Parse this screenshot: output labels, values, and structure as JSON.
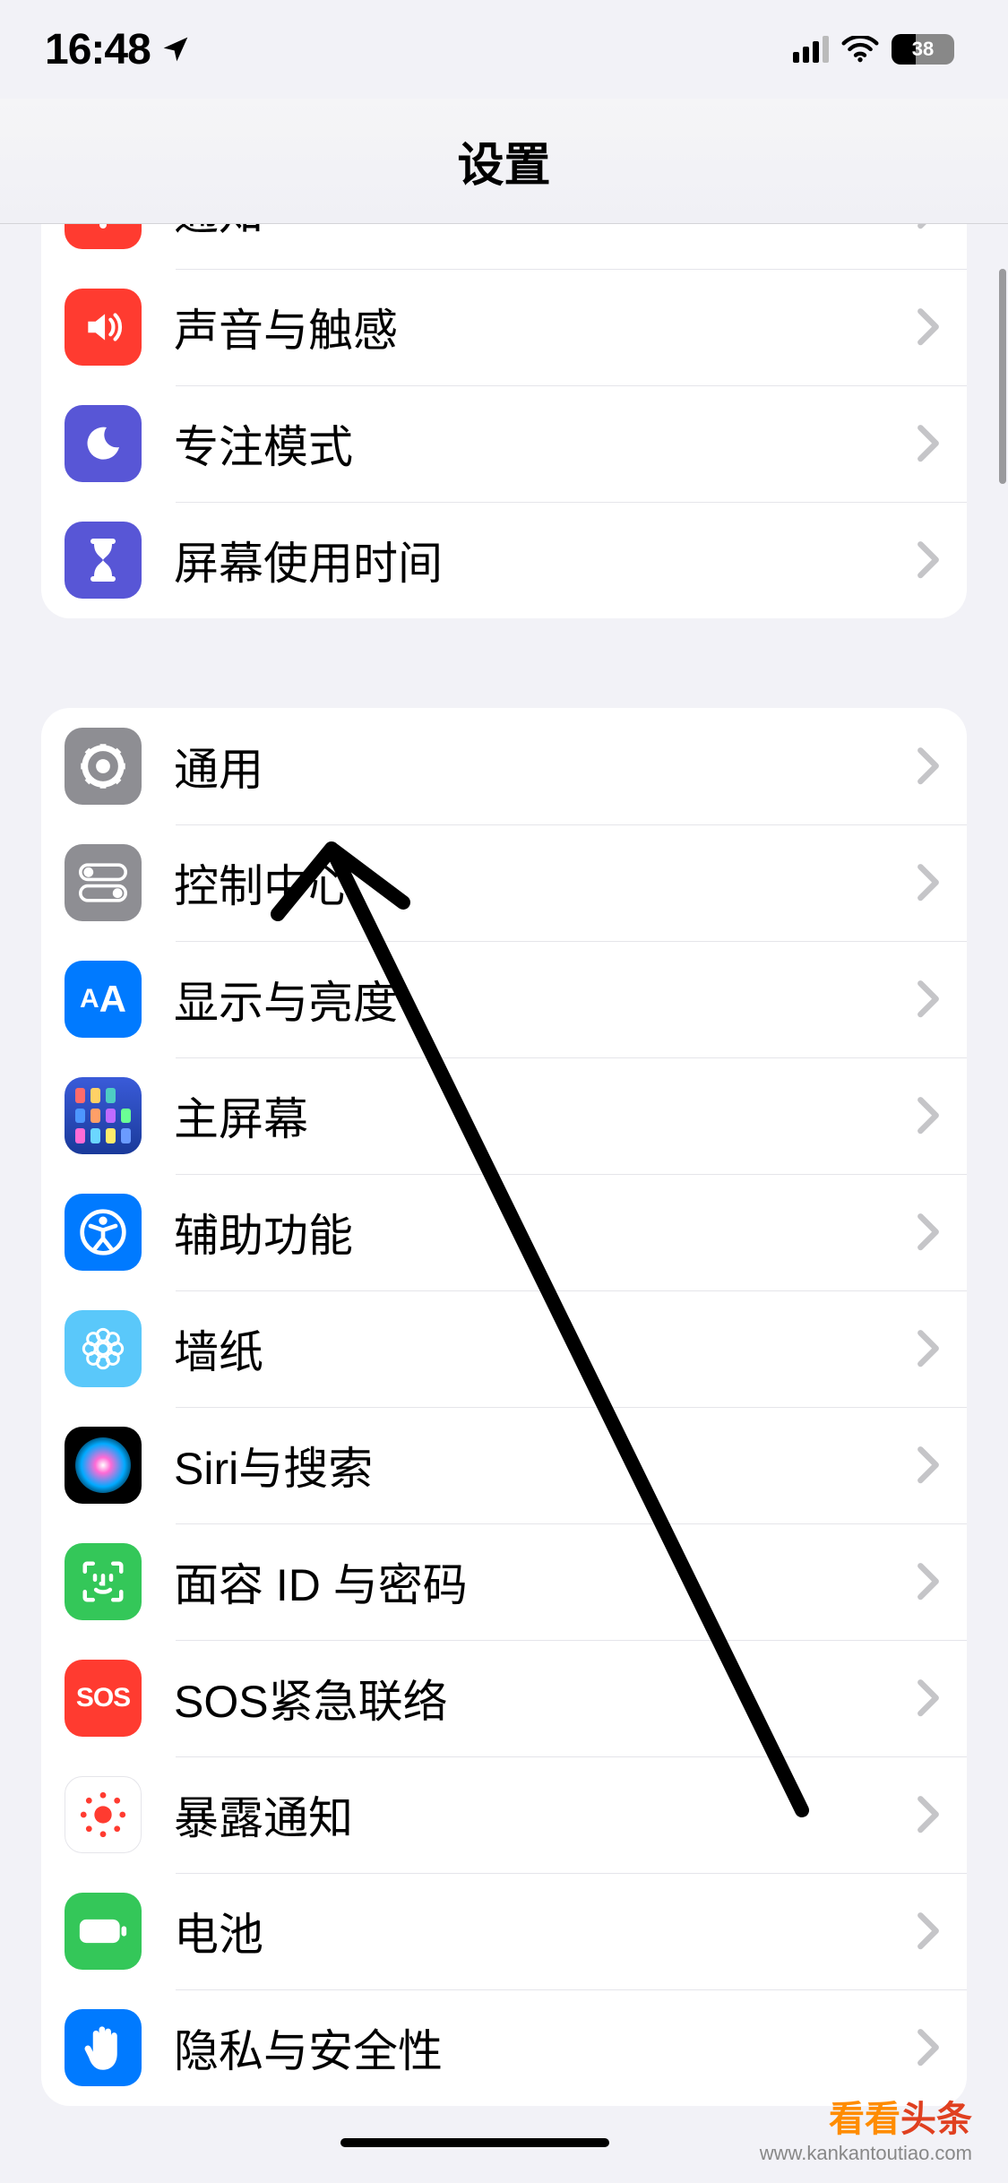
{
  "status_bar": {
    "time": "16:48",
    "battery_percent": "38"
  },
  "nav": {
    "title": "设置"
  },
  "group1": [
    {
      "id": "notifications",
      "label": "通知",
      "iconColor": "c-red",
      "svg": "bell"
    },
    {
      "id": "sounds",
      "label": "声音与触感",
      "iconColor": "c-red",
      "svg": "speaker"
    },
    {
      "id": "focus",
      "label": "专注模式",
      "iconColor": "c-indigo",
      "svg": "moon"
    },
    {
      "id": "screentime",
      "label": "屏幕使用时间",
      "iconColor": "c-indigo",
      "svg": "hourglass"
    }
  ],
  "group2": [
    {
      "id": "general",
      "label": "通用",
      "iconColor": "c-grey",
      "svg": "gear"
    },
    {
      "id": "controlcenter",
      "label": "控制中心",
      "iconColor": "c-grey",
      "svg": "switches"
    },
    {
      "id": "display",
      "label": "显示与亮度",
      "iconColor": "c-blue",
      "svg": "aA"
    },
    {
      "id": "homescreen",
      "label": "主屏幕",
      "iconColor": "c-darkblue",
      "svg": "grid"
    },
    {
      "id": "accessibility",
      "label": "辅助功能",
      "iconColor": "c-blue",
      "svg": "access"
    },
    {
      "id": "wallpaper",
      "label": "墙纸",
      "iconColor": "c-cyan",
      "svg": "flower"
    },
    {
      "id": "siri",
      "label": "Siri与搜索",
      "iconColor": "c-black",
      "svg": "siri"
    },
    {
      "id": "faceid",
      "label": "面容 ID 与密码",
      "iconColor": "c-green",
      "svg": "faceid"
    },
    {
      "id": "sos",
      "label": "SOS紧急联络",
      "iconColor": "c-softred",
      "svg": "sos"
    },
    {
      "id": "exposure",
      "label": "暴露通知",
      "iconColor": "c-white",
      "svg": "exposure"
    },
    {
      "id": "battery",
      "label": "电池",
      "iconColor": "c-green",
      "svg": "battery"
    },
    {
      "id": "privacy",
      "label": "隐私与安全性",
      "iconColor": "c-blue",
      "svg": "hand"
    }
  ],
  "watermark": {
    "main1": "看看",
    "main2": "头条",
    "sub": "www.kankantoutiao.com"
  }
}
